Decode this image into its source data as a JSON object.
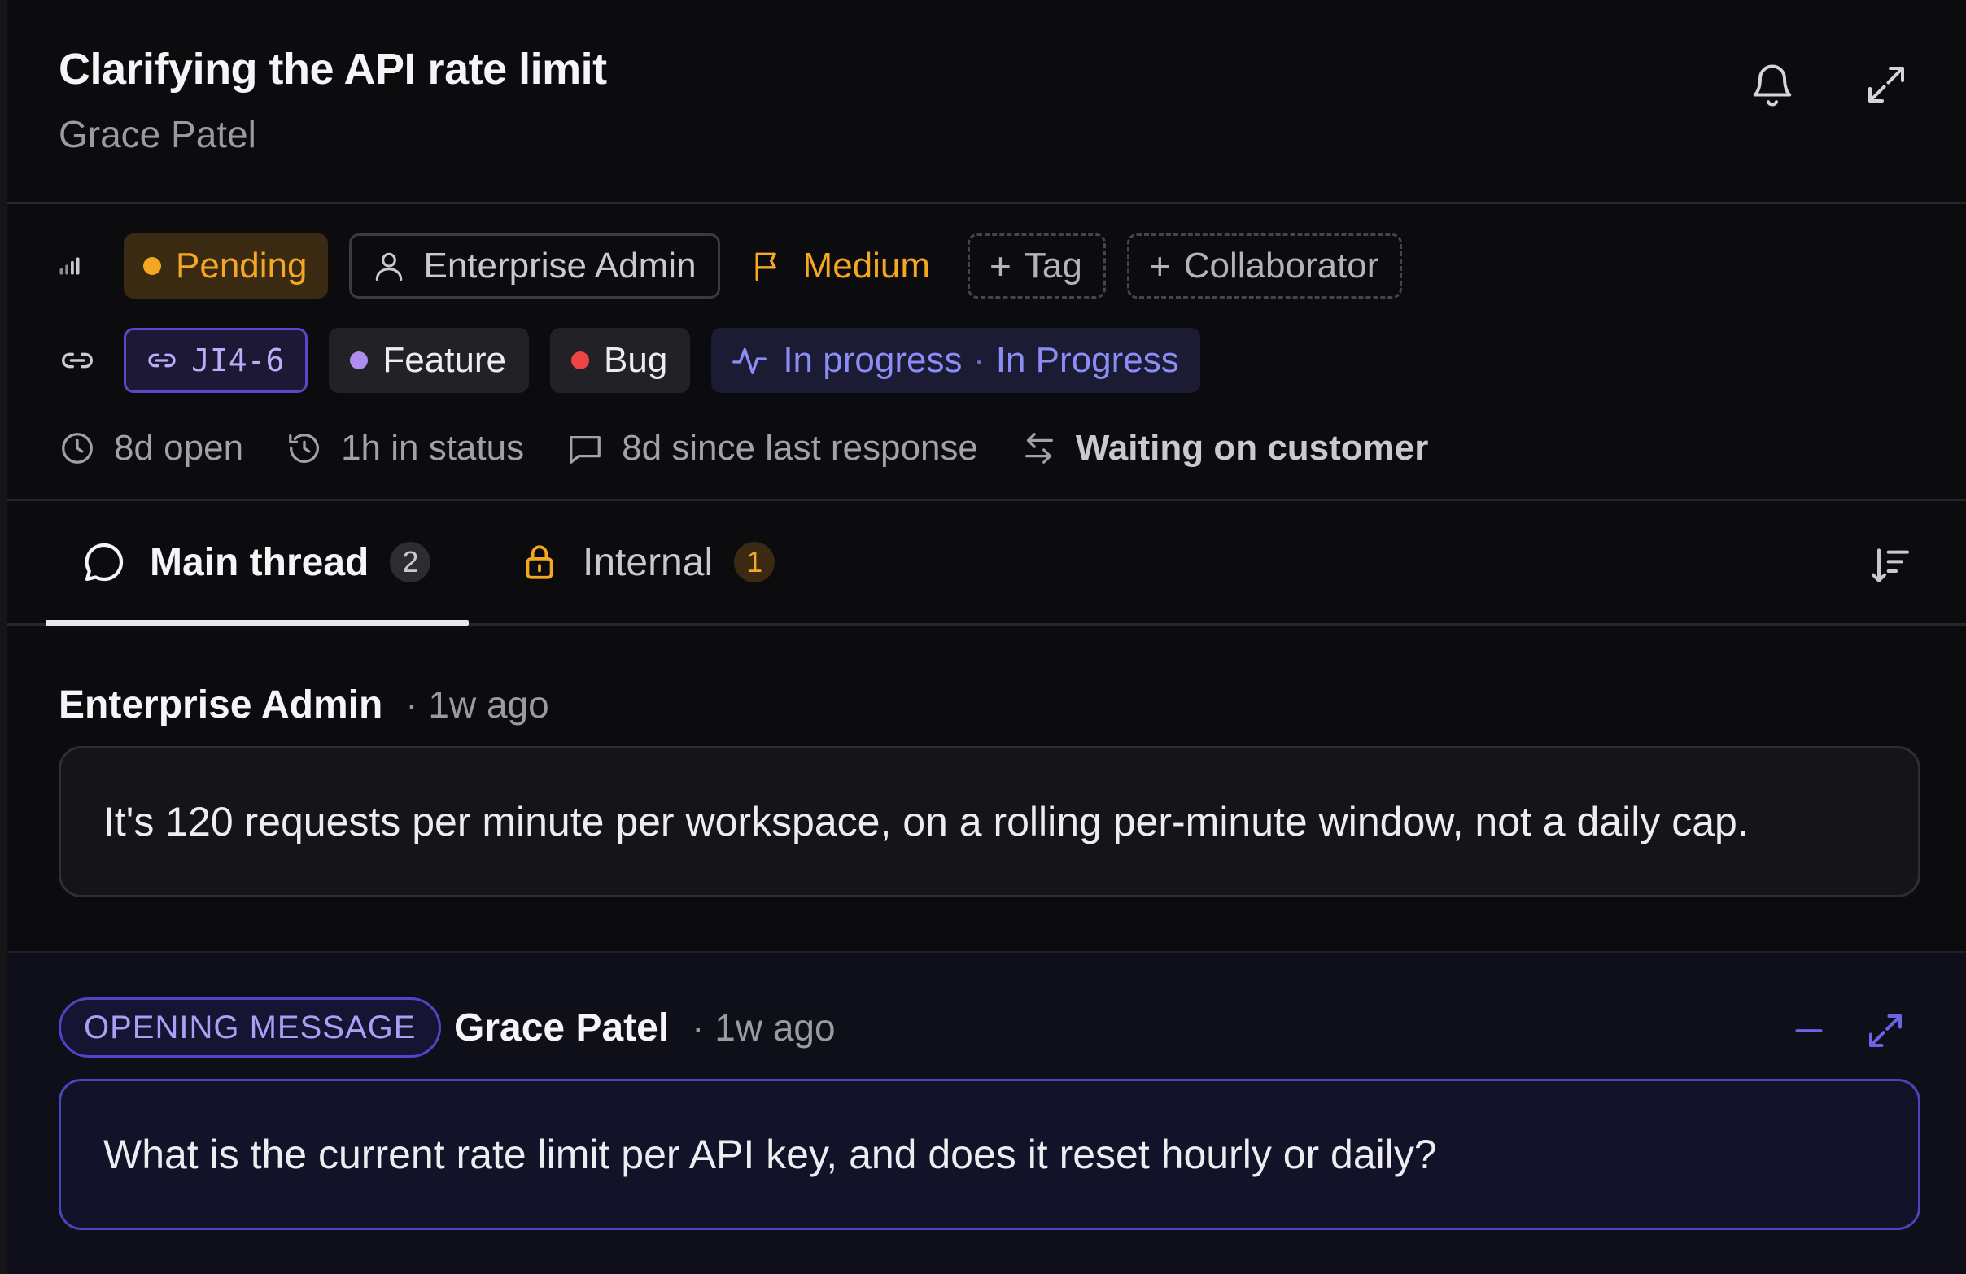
{
  "ticket": {
    "title": "Clarifying the API rate limit",
    "requester": "Grace Patel"
  },
  "properties": {
    "status": "Pending",
    "assignee": "Enterprise Admin",
    "priority": "Medium",
    "tag_button": "Tag",
    "collaborator_button": "Collaborator"
  },
  "links": {
    "jira_key": "JI4-6",
    "labels": [
      "Feature",
      "Bug"
    ],
    "progress_status": "In progress",
    "progress_state": "In Progress"
  },
  "stats": {
    "open": "8d open",
    "in_status": "1h in status",
    "since_response": "8d since last response",
    "waiting": "Waiting on customer"
  },
  "tabs": [
    {
      "label": "Main thread",
      "count": "2"
    },
    {
      "label": "Internal",
      "count": "1"
    }
  ],
  "messages": [
    {
      "author": "Enterprise Admin",
      "time": "· 1w ago",
      "body": "It's 120 requests per minute per workspace, on a rolling per-minute window, not a daily cap."
    },
    {
      "badge": "OPENING MESSAGE",
      "author": "Grace Patel",
      "time": "· 1w ago",
      "body": "What is the current rate limit per API key, and does it reset hourly or daily?"
    }
  ],
  "colors": {
    "background": "#0c0c0e",
    "pending": "#f5a623",
    "accent": "#5b47c8",
    "progress": "#8b8cf5",
    "bug": "#ef4444",
    "feature": "#b08cf0"
  },
  "icons": [
    "bell-icon",
    "expand-icon",
    "signal-icon",
    "user-icon",
    "flag-icon",
    "link-icon",
    "activity-icon",
    "clock-icon",
    "history-icon",
    "chat-icon",
    "swap-icon",
    "lock-icon",
    "sort-icon",
    "minimize-icon"
  ]
}
